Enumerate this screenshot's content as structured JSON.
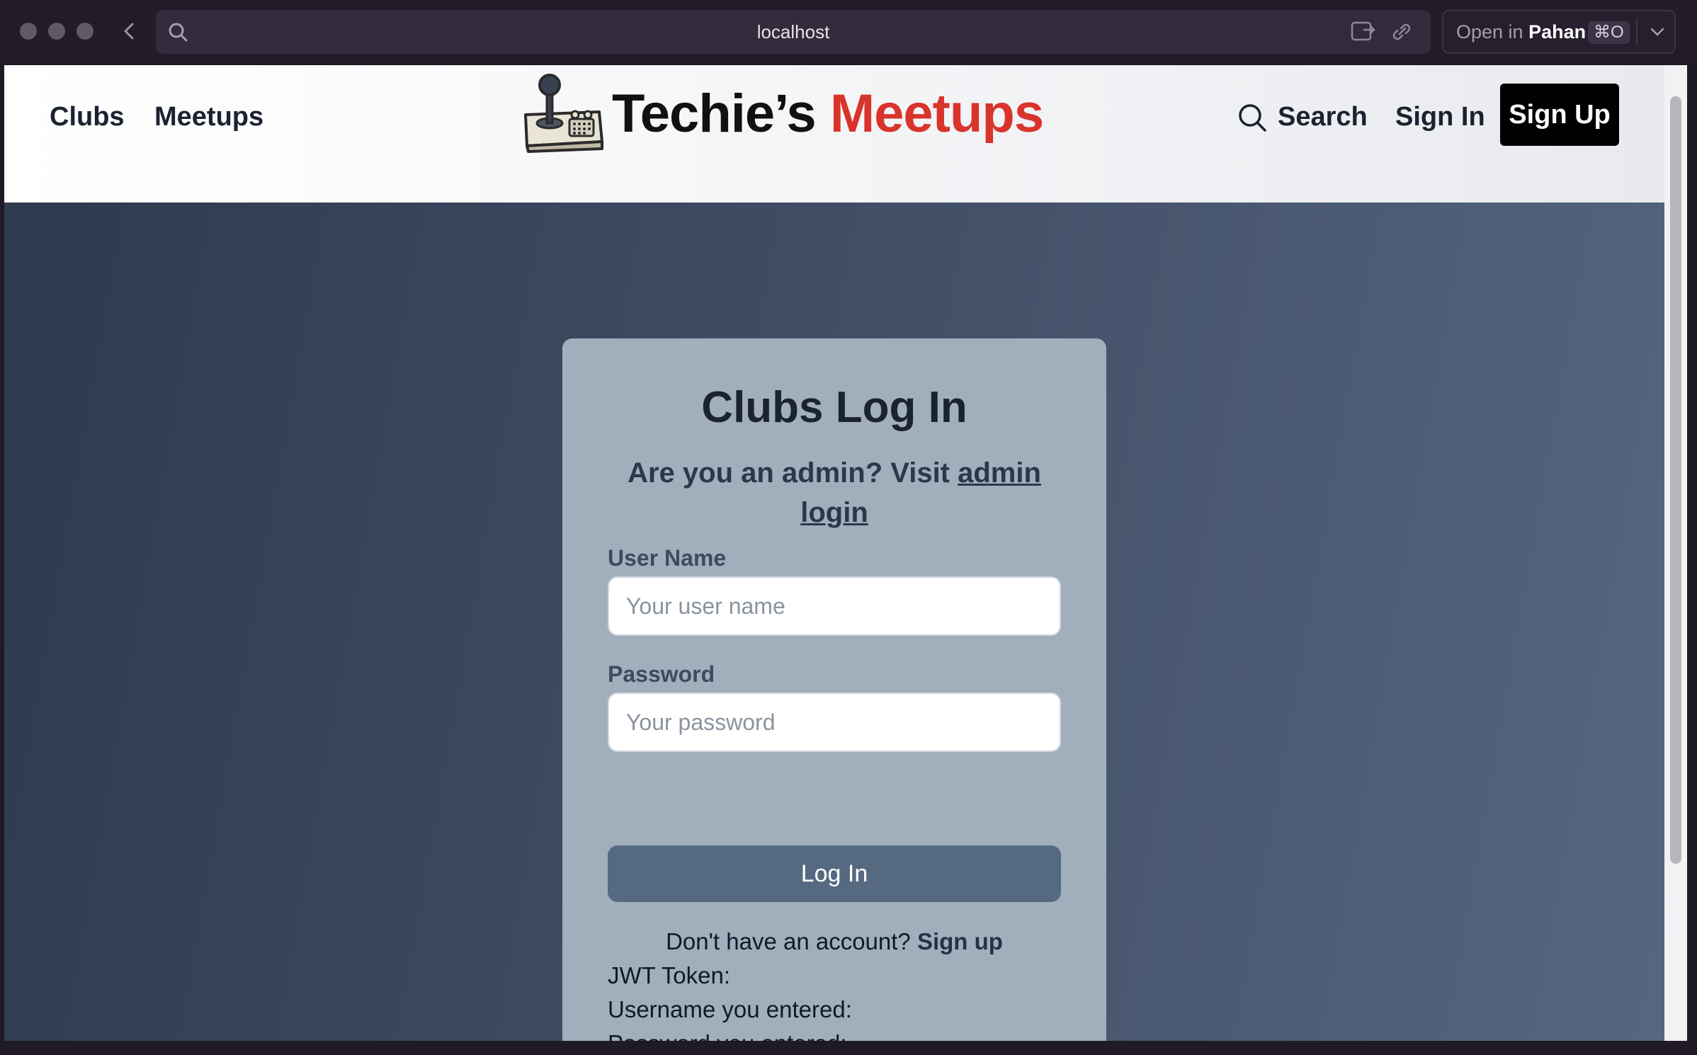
{
  "browser": {
    "url": "localhost",
    "open_in": {
      "prefix": "Open in",
      "app": "Pahan",
      "shortcut": "⌘O"
    }
  },
  "header": {
    "nav": [
      "Clubs",
      "Meetups"
    ],
    "logo": {
      "part1": "Techie’s",
      "part2": "Meetups"
    },
    "search_label": "Search",
    "signin_label": "Sign In",
    "signup_label": "Sign Up"
  },
  "login": {
    "title": "Clubs Log In",
    "admin_prefix": "Are you an admin? Visit",
    "admin_link": "admin login",
    "username_label": "User Name",
    "username_placeholder": "Your user name",
    "password_label": "Password",
    "password_placeholder": "Your password",
    "submit_label": "Log In",
    "signup_prompt": "Don't have an account?",
    "signup_link": "Sign up",
    "jwt_label": "JWT Token:",
    "username_entered_label": "Username you entered:",
    "password_entered_label": "Password you entered:"
  },
  "colors": {
    "accent": "#d9342b",
    "card_bg": "#a1afbd",
    "button_bg": "#556a80"
  }
}
